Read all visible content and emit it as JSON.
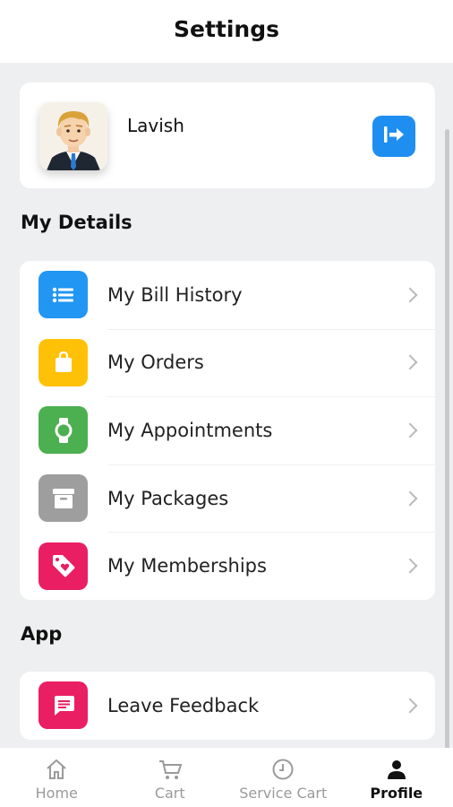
{
  "header": {
    "title": "Settings"
  },
  "profile": {
    "name": "Lavish",
    "logout_icon": "logout-icon",
    "accent": "#1f8ef1"
  },
  "sections": {
    "my_details": {
      "title": "My Details",
      "items": [
        {
          "label": "My Bill History",
          "icon": "list-icon",
          "color": "#2196f3"
        },
        {
          "label": "My Orders",
          "icon": "shopping-bag-icon",
          "color": "#ffc107"
        },
        {
          "label": "My Appointments",
          "icon": "watch-icon",
          "color": "#4caf50"
        },
        {
          "label": "My Packages",
          "icon": "archive-box-icon",
          "color": "#9e9e9e"
        },
        {
          "label": "My Memberships",
          "icon": "tag-heart-icon",
          "color": "#e91e63"
        }
      ]
    },
    "app": {
      "title": "App",
      "items": [
        {
          "label": "Leave Feedback",
          "icon": "chat-icon",
          "color": "#e91e63"
        }
      ]
    }
  },
  "tabbar": {
    "tabs": [
      {
        "label": "Home",
        "icon": "home-icon",
        "active": false
      },
      {
        "label": "Cart",
        "icon": "cart-icon",
        "active": false
      },
      {
        "label": "Service Cart",
        "icon": "clock-icon",
        "active": false
      },
      {
        "label": "Profile",
        "icon": "person-icon",
        "active": true
      }
    ]
  }
}
